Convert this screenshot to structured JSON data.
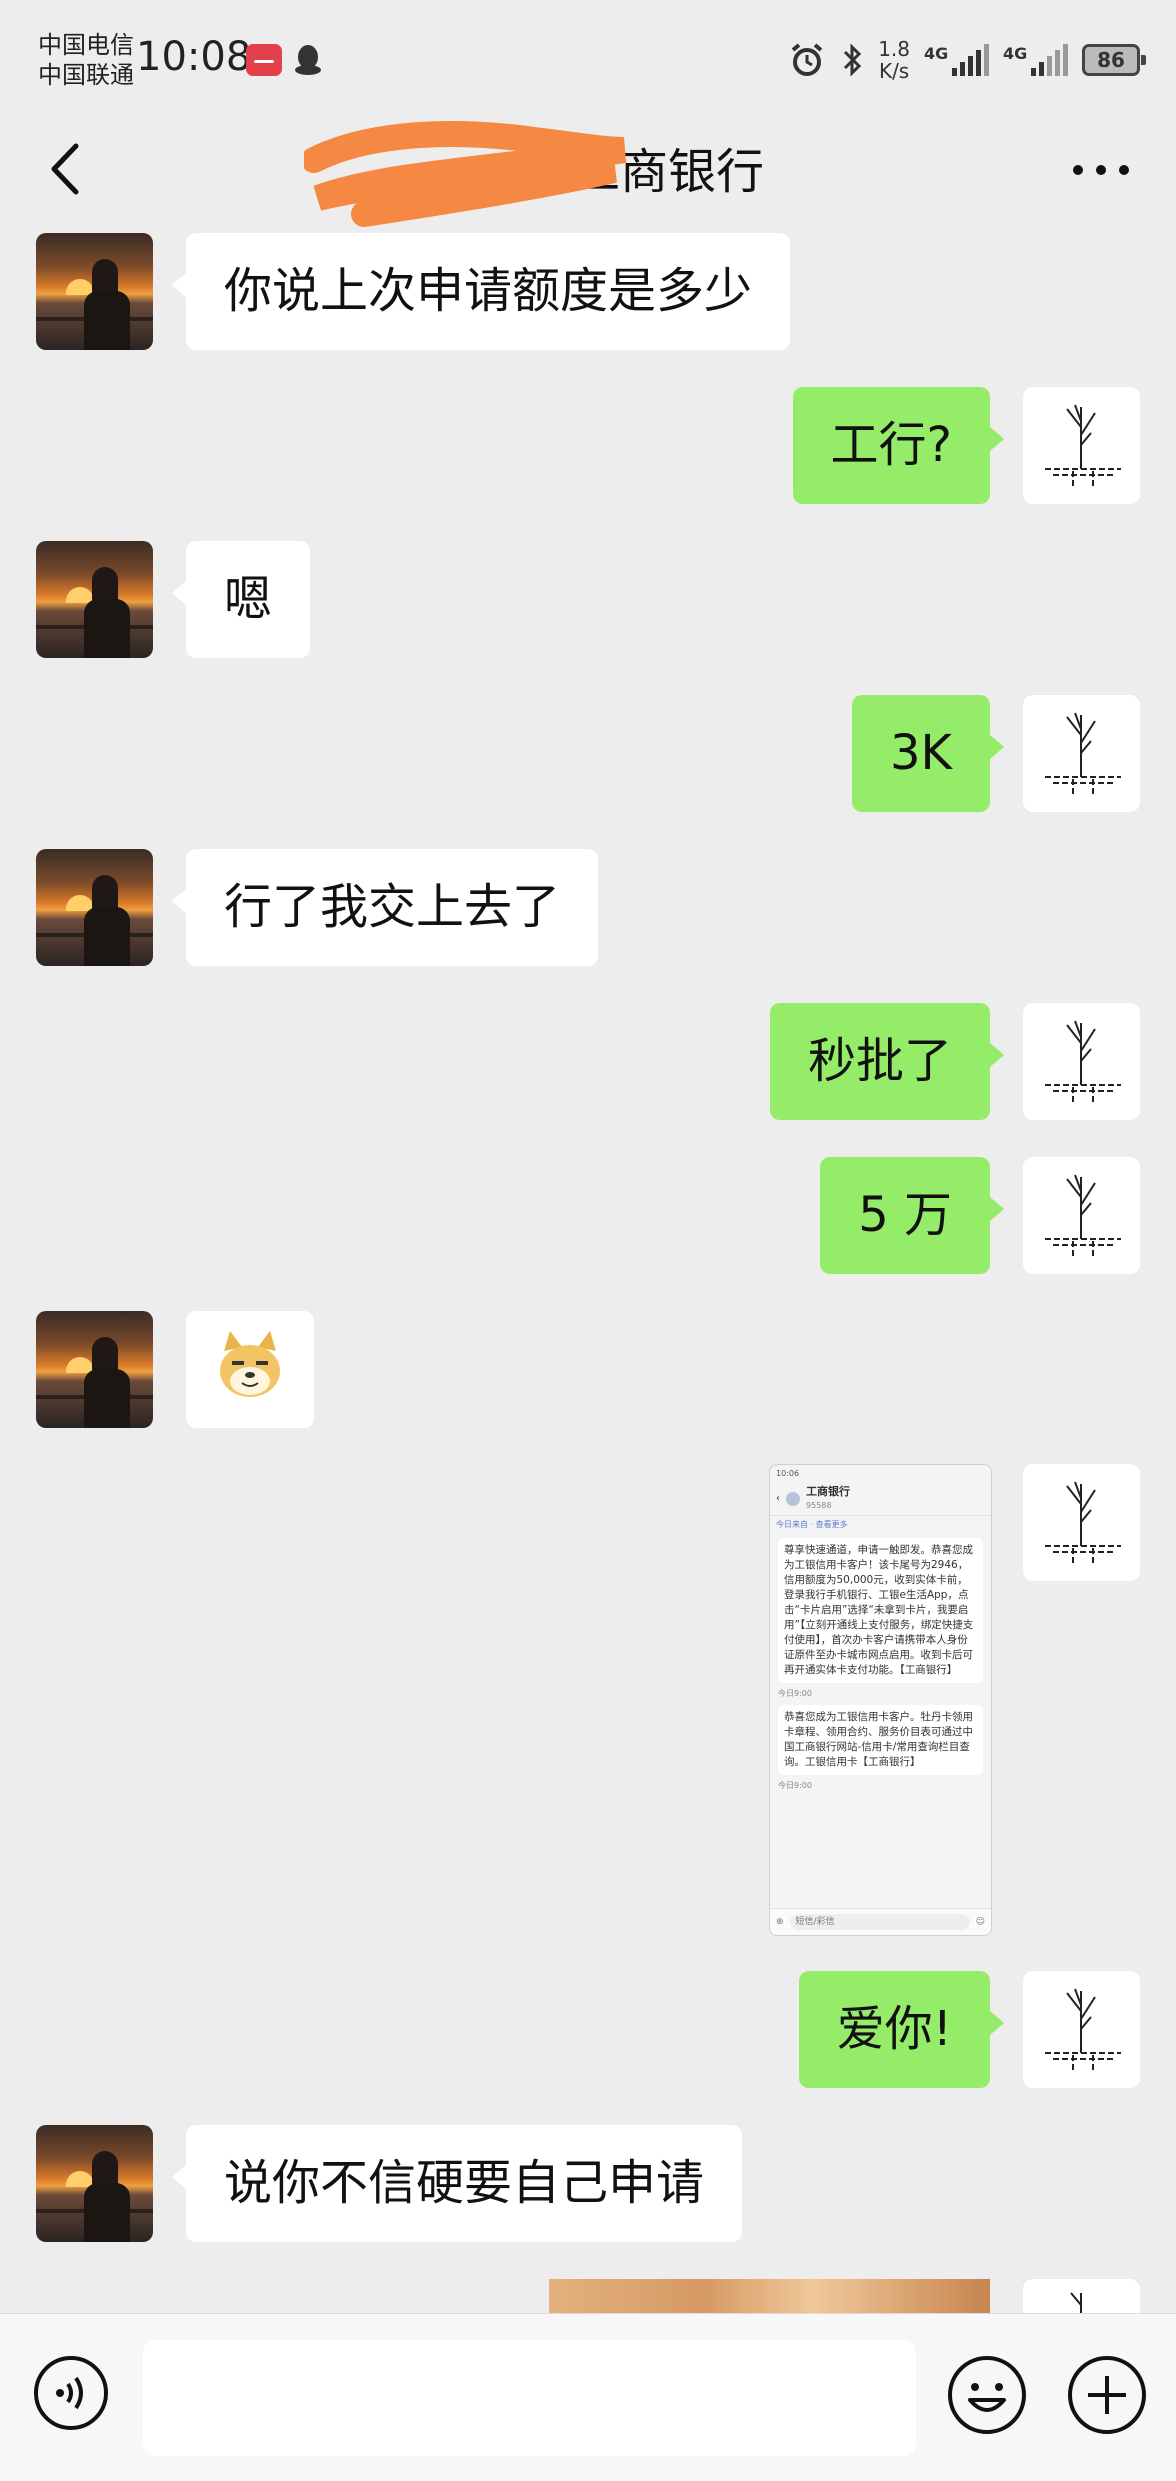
{
  "status_bar": {
    "carrier_1": "中国电信",
    "carrier_2": "中国联通",
    "time": "10:08",
    "speed_value": "1.8",
    "speed_unit": "K/s",
    "signal_1": "4G",
    "signal_2": "4G",
    "battery": "86"
  },
  "header": {
    "title_visible": "工商银行"
  },
  "messages": [
    {
      "side": "left",
      "text": "你说上次申请额度是多少"
    },
    {
      "side": "right",
      "text": "工行?"
    },
    {
      "side": "left",
      "text": "嗯"
    },
    {
      "side": "right",
      "text": "3K"
    },
    {
      "side": "left",
      "text": "行了我交上去了"
    },
    {
      "side": "right",
      "text": "秒批了"
    },
    {
      "side": "right",
      "text": "5 万"
    },
    {
      "side": "left",
      "type": "sticker",
      "icon": "doge-emoji-icon"
    },
    {
      "side": "right",
      "type": "image",
      "description": "sms-screenshot"
    },
    {
      "side": "right",
      "text": "爱你!"
    },
    {
      "side": "left",
      "text": "说你不信硬要自己申请"
    },
    {
      "side": "right",
      "type": "image",
      "description": "photo"
    }
  ],
  "sms_screenshot": {
    "status_time": "10:06",
    "sender": "工商银行",
    "number": "95588",
    "info_line": "今日来自 · 查看更多",
    "sms_1": "尊享快速通道，申请一触即发。恭喜您成为工银信用卡客户！该卡尾号为2946，信用额度为50,000元，收到实体卡前，登录我行手机银行、工银e生活App，点击“卡片启用”选择“未拿到卡片，我要启用”【立刻开通线上支付服务，绑定快捷支付使用】，首次办卡客户请携带本人身份证原件至办卡城市网点启用。收到卡后可再开通实体卡支付功能。【工商银行】",
    "time_1": "今日9:00",
    "sms_2": "恭喜您成为工银信用卡客户。牡丹卡领用卡章程、领用合约、服务价目表可通过中国工商银行网站-信用卡/常用查询栏目查询。工银信用卡【工商银行】",
    "time_2": "今日9:00",
    "input_placeholder": "短信/彩信"
  },
  "input_bar": {
    "value": "",
    "voice_icon": "voice-icon",
    "emoji_icon": "smiley-icon",
    "plus_icon": "plus-icon"
  },
  "colors": {
    "background": "#ededed",
    "bubble_left": "#ffffff",
    "bubble_right": "#95ec69",
    "scribble": "#f58842"
  }
}
